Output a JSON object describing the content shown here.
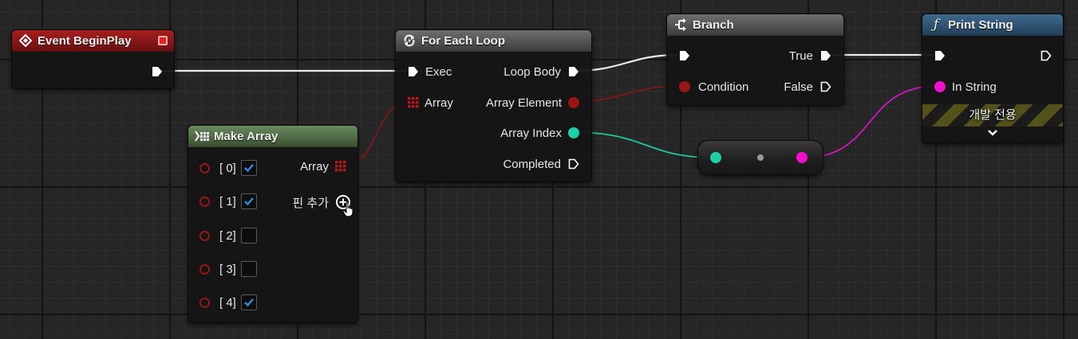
{
  "colors": {
    "exec": "#ffffff",
    "object": "#9b1515",
    "integer": "#1ed0a8",
    "string": "#f20fc8",
    "event_header": "#8c1515",
    "function_header": "#294f6e",
    "pure_header": "#4f6b46",
    "macro_header": "#5c5c5c",
    "check": "#2e8ee6"
  },
  "nodes": {
    "event_begin_play": {
      "title": "Event BeginPlay",
      "icon": "event-diamond-icon"
    },
    "make_array": {
      "title": "Make Array",
      "icon": "make-array-icon",
      "output_label": "Array",
      "add_pin_label": "핀 추가",
      "elements": [
        {
          "label": "[ 0]",
          "checked": true
        },
        {
          "label": "[ 1]",
          "checked": true
        },
        {
          "label": "[ 2]",
          "checked": false
        },
        {
          "label": "[ 3]",
          "checked": false
        },
        {
          "label": "[ 4]",
          "checked": true
        }
      ]
    },
    "for_each_loop": {
      "title": "For Each Loop",
      "icon": "loop-icon",
      "inputs": {
        "exec": "Exec",
        "array": "Array"
      },
      "outputs": {
        "loop_body": "Loop Body",
        "array_element": "Array Element",
        "array_index": "Array Index",
        "completed": "Completed"
      }
    },
    "branch": {
      "title": "Branch",
      "icon": "branch-icon",
      "inputs": {
        "condition": "Condition"
      },
      "outputs": {
        "true": "True",
        "false": "False"
      }
    },
    "print_string": {
      "title": "Print String",
      "icon": "function-icon",
      "inputs": {
        "in_string": "In String"
      },
      "dev_only_label": "개발 전용"
    }
  }
}
